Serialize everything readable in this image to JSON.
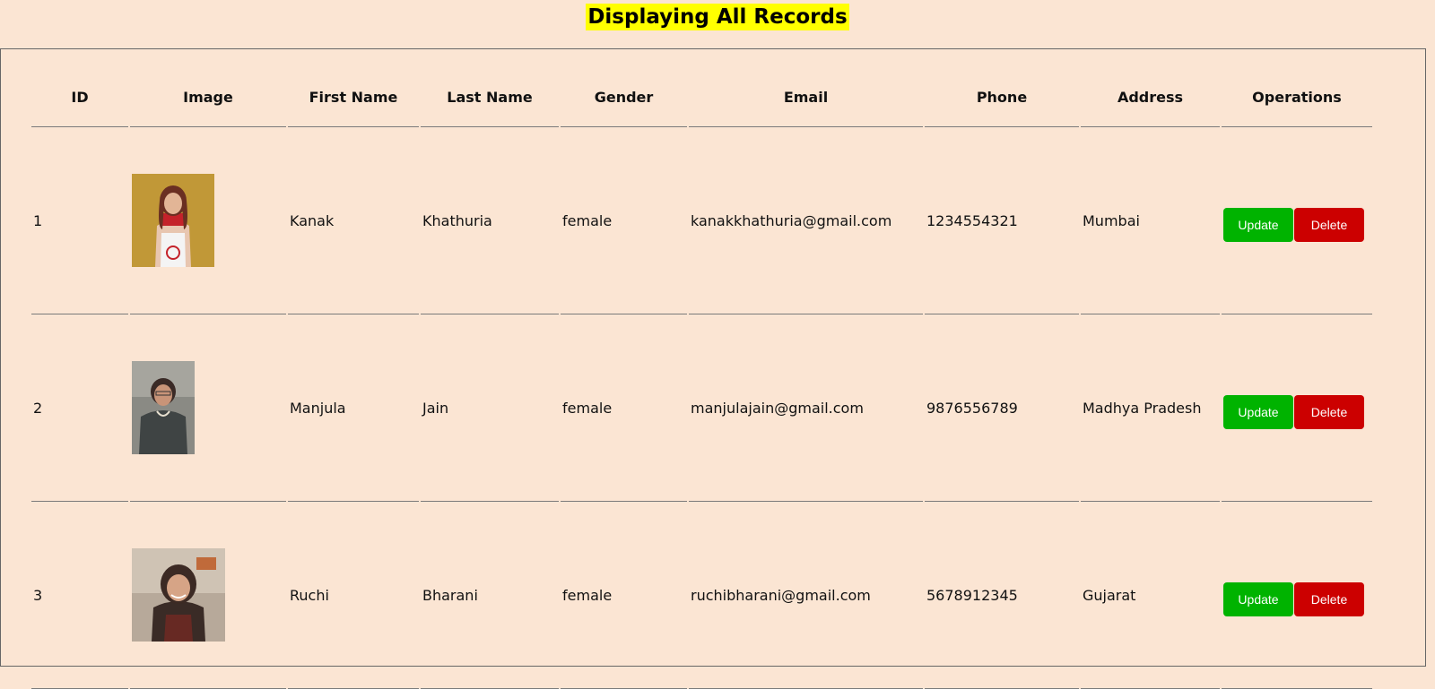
{
  "page": {
    "title": "Displaying All Records"
  },
  "table": {
    "headers": {
      "id": "ID",
      "image": "Image",
      "first_name": "First Name",
      "last_name": "Last Name",
      "gender": "Gender",
      "email": "Email",
      "phone": "Phone",
      "address": "Address",
      "operations": "Operations"
    },
    "rows": [
      {
        "id": "1",
        "first_name": "Kanak",
        "last_name": "Khathuria",
        "gender": "female",
        "email": "kanakkhathuria@gmail.com",
        "phone": "1234554321",
        "address": "Mumbai",
        "update_label": "Update",
        "delete_label": "Delete"
      },
      {
        "id": "2",
        "first_name": "Manjula",
        "last_name": "Jain",
        "gender": "female",
        "email": "manjulajain@gmail.com",
        "phone": "9876556789",
        "address": "Madhya Pradesh",
        "update_label": "Update",
        "delete_label": "Delete"
      },
      {
        "id": "3",
        "first_name": "Ruchi",
        "last_name": "Bharani",
        "gender": "female",
        "email": "ruchibharani@gmail.com",
        "phone": "5678912345",
        "address": "Gujarat",
        "update_label": "Update",
        "delete_label": "Delete"
      }
    ]
  },
  "colors": {
    "background": "#fbe5d3",
    "title_highlight": "#ffff00",
    "update_button": "#00b300",
    "delete_button": "#cc0000"
  }
}
